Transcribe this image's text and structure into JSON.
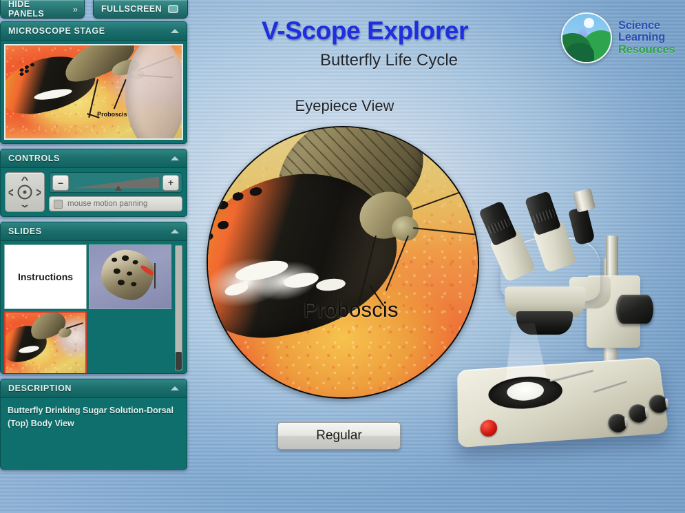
{
  "topbar": {
    "hide_panels_label": "HIDE PANELS",
    "hide_panels_icon": "double-chevron-right-icon",
    "fullscreen_label": "FULLSCREEN",
    "fullscreen_icon": "screen-icon"
  },
  "header": {
    "title": "V-Scope Explorer",
    "subtitle": "Butterfly Life Cycle",
    "title_color": "#1f2ede"
  },
  "logo": {
    "line1": "Science",
    "line2": "Learning",
    "line3": "Resources",
    "mark": "circular-landscape-logo",
    "blue": "#2a4fb5",
    "green": "#2aa53f"
  },
  "panels": {
    "stage": {
      "title": "MICROSCOPE STAGE",
      "collapse_icon": "chevron-up-icon",
      "thumb_caption": "Proboscis"
    },
    "controls": {
      "title": "CONTROLS",
      "collapse_icon": "chevron-up-icon",
      "dpad_icon": "direction-pad-icon",
      "zoom_out_label": "–",
      "zoom_in_label": "+",
      "zoom_value": 53,
      "pan_checkbox_label": "mouse motion panning",
      "pan_checked": false
    },
    "slides": {
      "title": "SLIDES",
      "collapse_icon": "chevron-up-icon",
      "items": [
        {
          "label": "Instructions",
          "type": "text",
          "selected": false
        },
        {
          "label": "",
          "type": "image-butterfly-blue",
          "selected": false
        },
        {
          "label": "",
          "type": "image-butterfly-sugar",
          "selected": true
        }
      ],
      "scrollbar": "vertical-scrollbar"
    },
    "description": {
      "title": "DESCRIPTION",
      "collapse_icon": "chevron-up-icon",
      "text": "Butterfly Drinking Sugar Solution-Dorsal (Top) Body View"
    }
  },
  "eyepiece": {
    "label": "Eyepiece View",
    "annotation": "Proboscis"
  },
  "view_mode_button": {
    "label": "Regular"
  },
  "microscope": {
    "name": "stereo-microscope-illustration",
    "led": "power-indicator-red",
    "knobs": 3
  }
}
